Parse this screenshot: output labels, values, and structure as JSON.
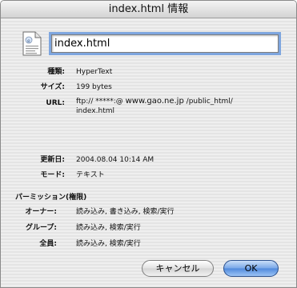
{
  "window": {
    "title": "index.html 情報"
  },
  "file": {
    "name": "index.html"
  },
  "info": {
    "kind_label": "種類:",
    "kind_value": "HyperText",
    "size_label": "サイズ:",
    "size_value": "199 bytes",
    "url_label": "URL:",
    "url_prefix": "ftp:// *****:@ ",
    "url_host": "www.gao.ne.jp",
    "url_suffix": " /public_html/",
    "url_line2": "index.html",
    "modified_label": "更新日:",
    "modified_value": "2004.08.04 10:14 AM",
    "mode_label": "モード:",
    "mode_value": "テキスト"
  },
  "permissions": {
    "heading": "パーミッション(権限)",
    "owner_label": "オーナー:",
    "owner_value": "読み込み, 書き込み, 検索/実行",
    "group_label": "グループ:",
    "group_value": "読み込み, 検索/実行",
    "all_label": "全員:",
    "all_value": "読み込み, 検索/実行"
  },
  "buttons": {
    "cancel": "キャンセル",
    "ok": "OK"
  },
  "icons": {
    "file": "document-icon"
  }
}
